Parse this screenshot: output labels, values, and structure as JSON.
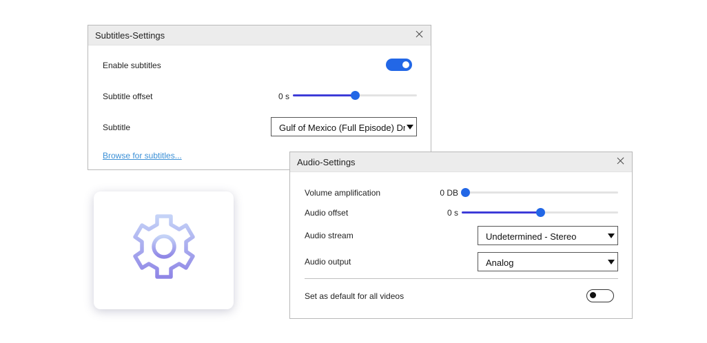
{
  "subtitles_dialog": {
    "title": "Subtitles-Settings",
    "enable_label": "Enable subtitles",
    "enable_on": true,
    "offset_label": "Subtitle offset",
    "offset_value": "0 s",
    "offset_fraction": 0.5,
    "subtitle_label": "Subtitle",
    "subtitle_selected": "Gulf of Mexico (Full Episode)  Dr",
    "browse_link": "Browse for subtitles..."
  },
  "audio_dialog": {
    "title": "Audio-Settings",
    "volume_label": "Volume amplification",
    "volume_value": "0 DB",
    "volume_fraction": 0.0,
    "offset_label": "Audio offset",
    "offset_value": "0 s",
    "offset_fraction": 0.5,
    "stream_label": "Audio stream",
    "stream_selected": "Undetermined - Stereo",
    "output_label": "Audio output",
    "output_selected": "Analog",
    "default_label": "Set as default for all videos",
    "default_on": false
  },
  "colors": {
    "accent": "#2267e6",
    "slider_fill": "#3d3bd8",
    "link": "#3a8fd6",
    "gear_gradient_top": "#c5d3f7",
    "gear_gradient_bottom": "#8f86e6"
  },
  "icons": {
    "gear": "gear-icon",
    "close": "close-icon",
    "dropdown": "chevron-down-icon"
  }
}
